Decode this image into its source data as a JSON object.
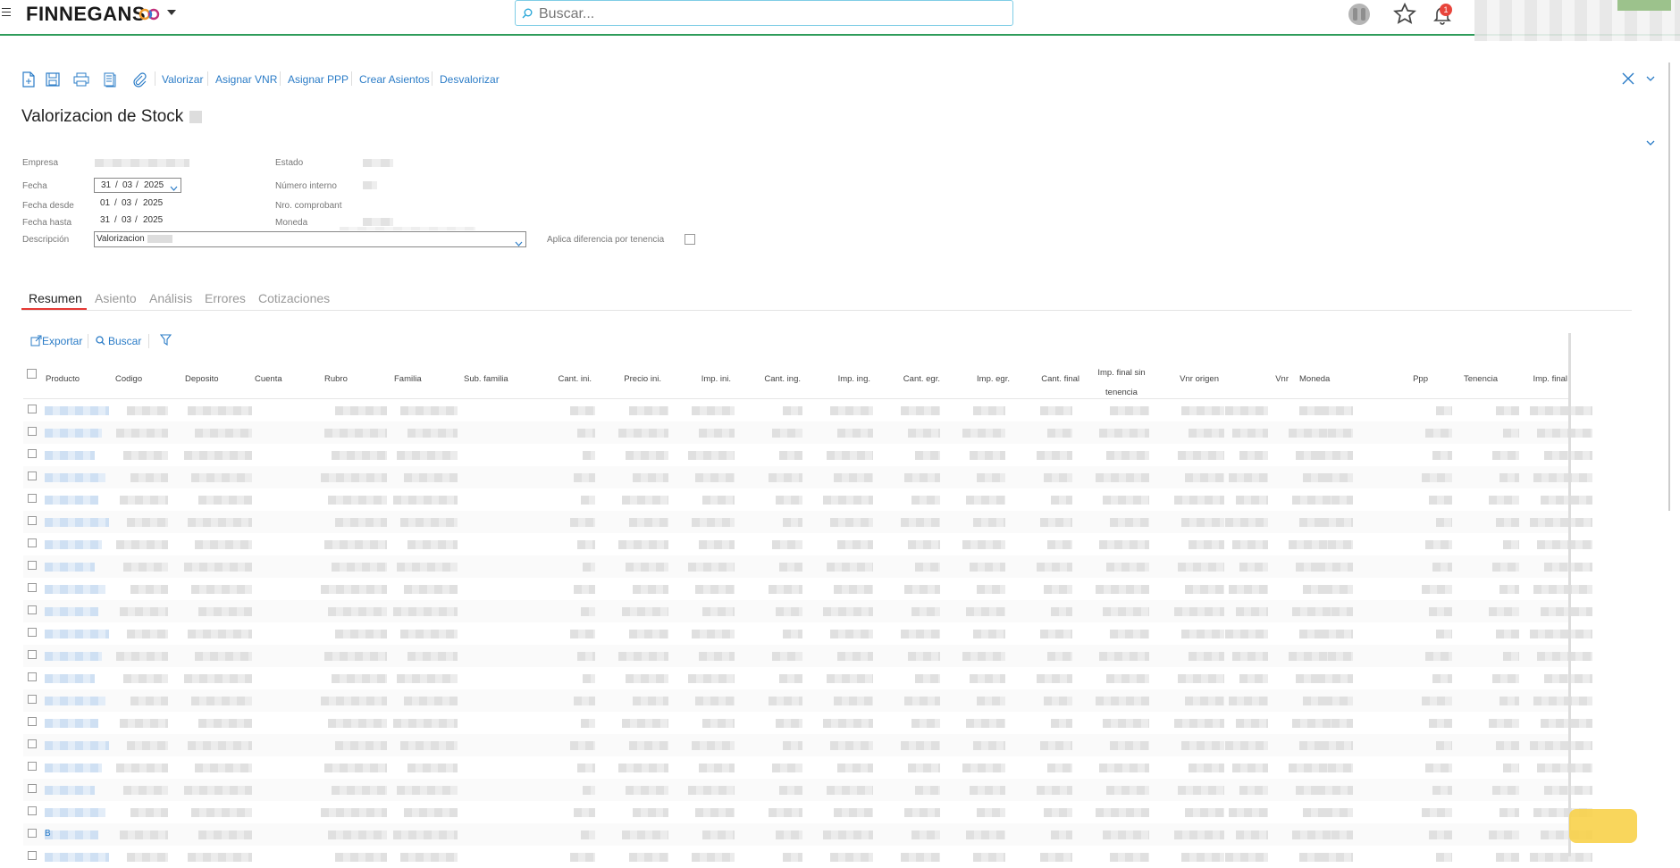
{
  "header": {
    "logo_text": "FINNEGANS",
    "search_placeholder": "Buscar...",
    "notification_count": "1"
  },
  "toolbar": {
    "links": [
      "Valorizar",
      "Asignar VNR",
      "Asignar PPP",
      "Crear Asientos",
      "Desvalorizar"
    ]
  },
  "page": {
    "title": "Valorizacion de Stock"
  },
  "form": {
    "empresa_label": "Empresa",
    "estado_label": "Estado",
    "fecha_label": "Fecha",
    "fecha_value": {
      "d": "31",
      "m": "03",
      "y": "2025"
    },
    "numero_interno_label": "Número interno",
    "fecha_desde_label": "Fecha desde",
    "fecha_desde_value": {
      "d": "01",
      "m": "03",
      "y": "2025"
    },
    "nro_comprobante_label": "Nro. comprobant",
    "fecha_hasta_label": "Fecha hasta",
    "fecha_hasta_value": {
      "d": "31",
      "m": "03",
      "y": "2025"
    },
    "moneda_label": "Moneda",
    "descripcion_label": "Descripción",
    "descripcion_value": "Valorizacion",
    "aplica_label": "Aplica diferencia por tenencia"
  },
  "tabs": [
    "Resumen",
    "Asiento",
    "Análisis",
    "Errores",
    "Cotizaciones"
  ],
  "grid": {
    "export_label": "Exportar",
    "search_label": "Buscar",
    "columns": [
      "Producto",
      "Codigo",
      "Deposito",
      "Cuenta",
      "Rubro",
      "Familia",
      "Sub. familia",
      "Cant. ini.",
      "Precio ini.",
      "Imp. ini.",
      "Cant. ing.",
      "Imp. ing.",
      "Cant. egr.",
      "Imp. egr.",
      "Cant. final",
      "Imp. final sin tenencia",
      "Vnr origen",
      "Vnr",
      "Moneda",
      "Ppp",
      "Tenencia",
      "Imp. final"
    ],
    "last_row_product_initial": "B"
  },
  "colors": {
    "accent_link": "#2b7cc7",
    "tab_active": "#e53935",
    "header_border": "#2e9c5a"
  }
}
